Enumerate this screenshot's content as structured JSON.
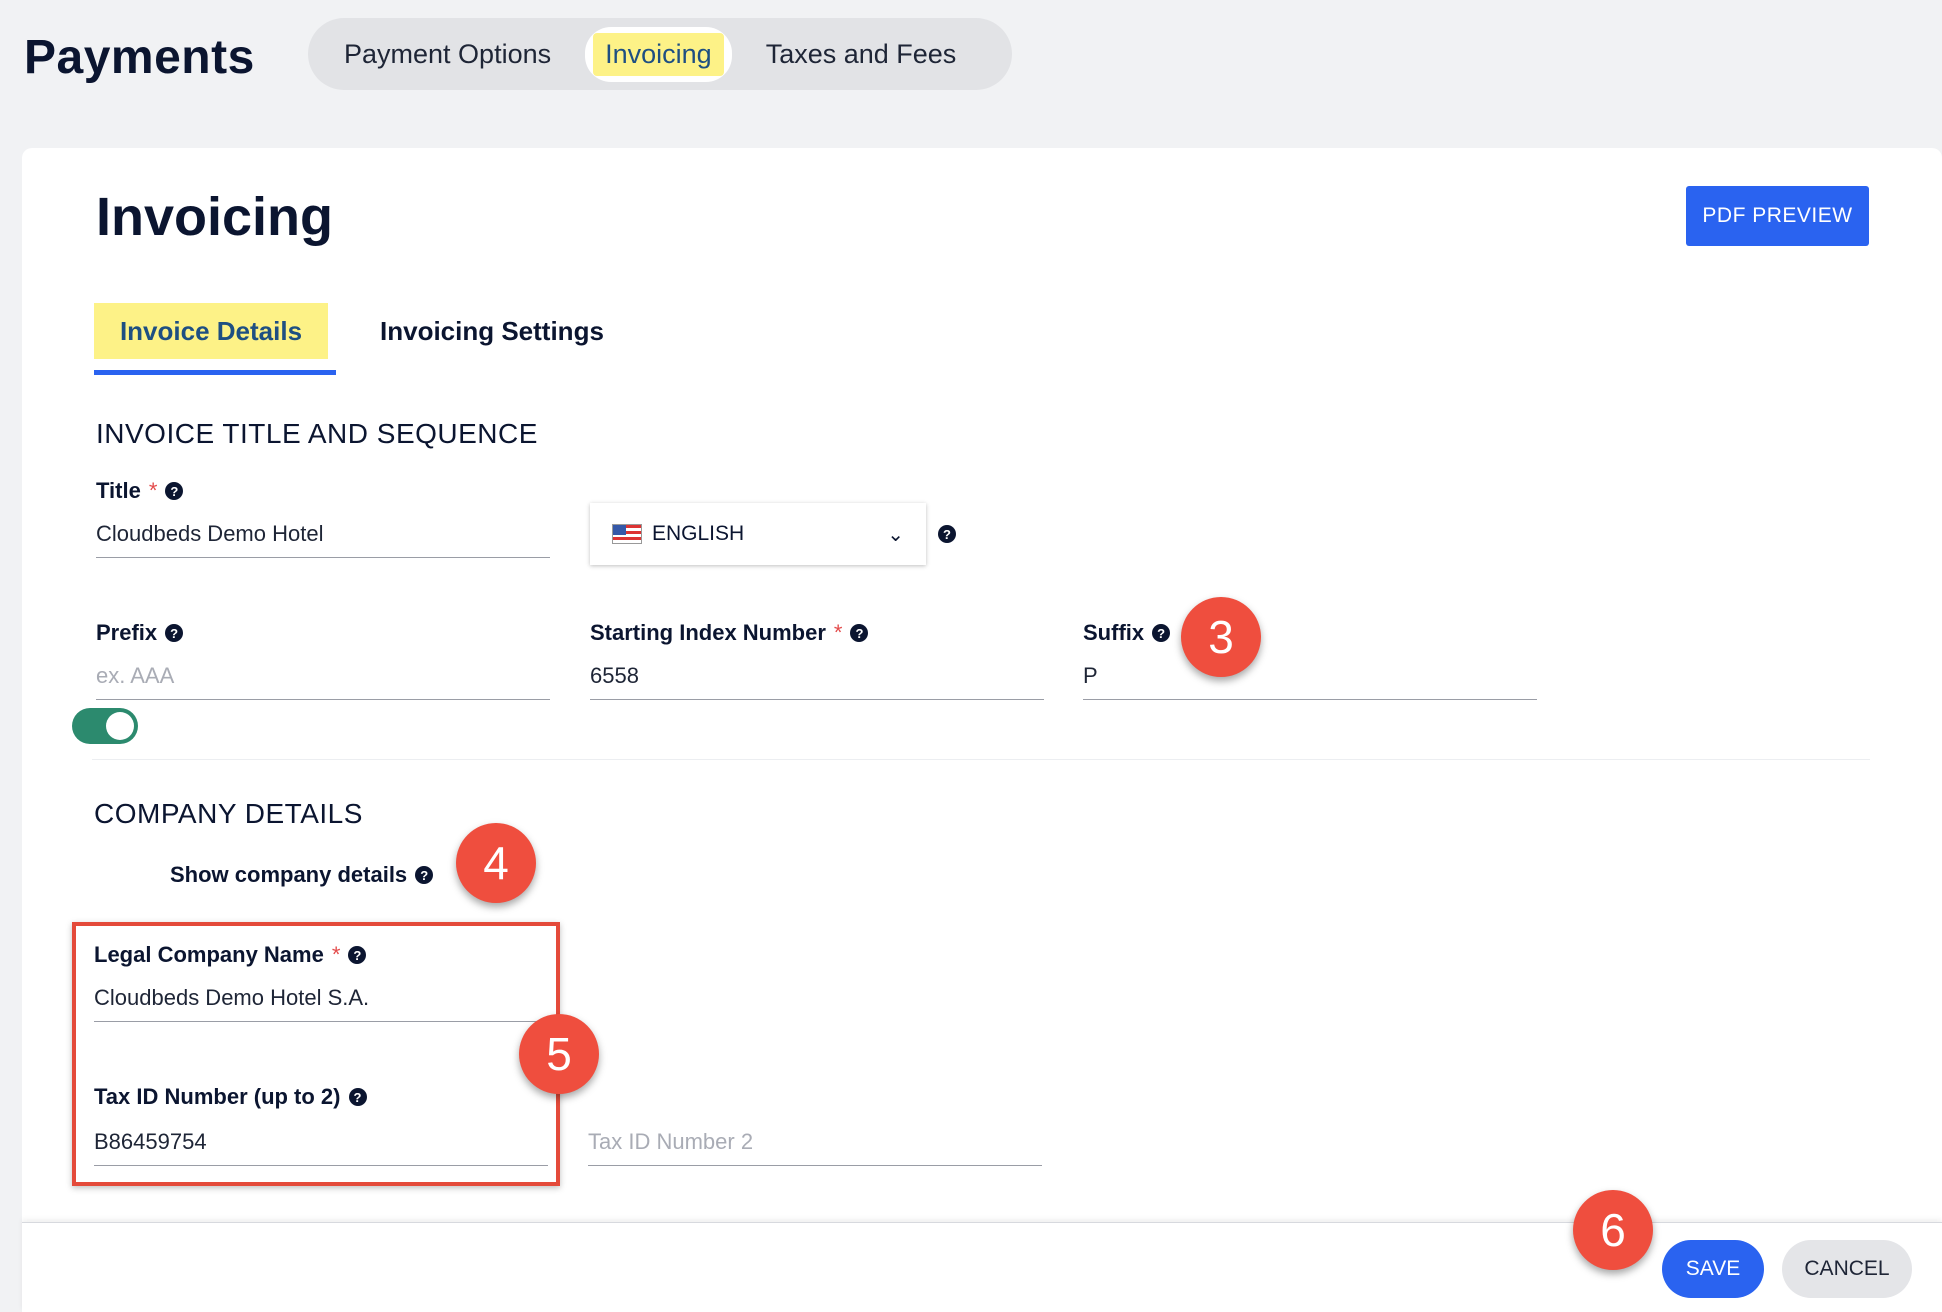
{
  "header": {
    "title": "Payments",
    "tabs": [
      {
        "label": "Payment Options"
      },
      {
        "label": "Invoicing"
      },
      {
        "label": "Taxes and Fees"
      }
    ]
  },
  "card": {
    "title": "Invoicing",
    "pdf_preview_label": "PDF PREVIEW",
    "subtabs": [
      {
        "label": "Invoice Details"
      },
      {
        "label": "Invoicing Settings"
      }
    ]
  },
  "sequence": {
    "heading": "INVOICE TITLE AND SEQUENCE",
    "title_label": "Title",
    "title_value": "Cloudbeds Demo Hotel",
    "language": "ENGLISH",
    "prefix_label": "Prefix",
    "prefix_placeholder": "ex. AAA",
    "start_label": "Starting Index Number",
    "start_value": "6558",
    "suffix_label": "Suffix",
    "suffix_value": "P"
  },
  "company": {
    "heading": "COMPANY DETAILS",
    "toggle_label": "Show company details",
    "toggle_on": true,
    "legal_label": "Legal Company Name",
    "legal_value": "Cloudbeds Demo Hotel S.A.",
    "tax_label": "Tax ID Number (up to 2)",
    "tax_value": "B86459754",
    "tax2_placeholder": "Tax ID Number 2"
  },
  "footer": {
    "save_label": "SAVE",
    "cancel_label": "CANCEL"
  },
  "annotations": [
    "3",
    "4",
    "5",
    "6"
  ],
  "colors": {
    "primary": "#2a63f0",
    "highlight": "#fdf287",
    "toggle": "#2c8a6e",
    "callout": "#ef4e3e"
  }
}
